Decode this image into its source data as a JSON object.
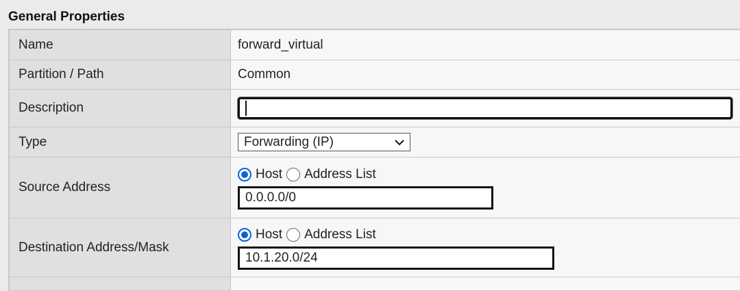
{
  "section": {
    "title": "General Properties"
  },
  "rows": {
    "name": {
      "label": "Name",
      "value": "forward_virtual"
    },
    "partition": {
      "label": "Partition / Path",
      "value": "Common"
    },
    "description": {
      "label": "Description",
      "value": ""
    },
    "type": {
      "label": "Type",
      "selected": "Forwarding (IP)"
    },
    "source": {
      "label": "Source Address",
      "option_host": "Host",
      "option_list": "Address List",
      "selected_option": "Host",
      "value": "0.0.0.0/0"
    },
    "destination": {
      "label": "Destination Address/Mask",
      "option_host": "Host",
      "option_list": "Address List",
      "selected_option": "Host",
      "value": "10.1.20.0/24"
    }
  },
  "colors": {
    "accent": "#0b63d6",
    "label_bg": "#e0e0e0",
    "value_bg": "#f7f7f7"
  }
}
